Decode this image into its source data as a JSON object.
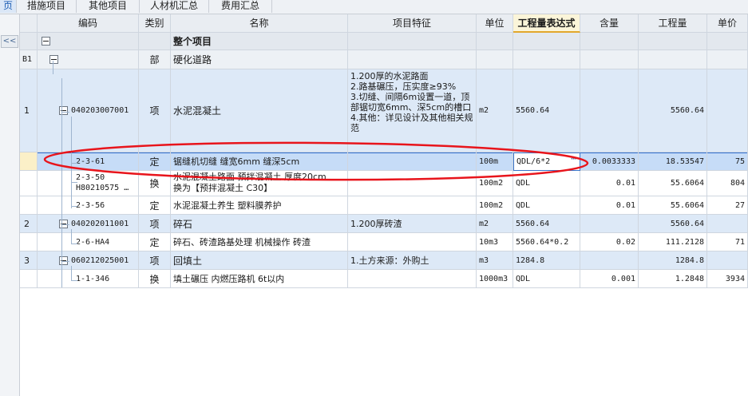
{
  "tabs": [
    {
      "label": "措施项目"
    },
    {
      "label": "其他项目"
    },
    {
      "label": "人材机汇总"
    },
    {
      "label": "费用汇总"
    }
  ],
  "left_panel": {
    "collapse_glyph": "<<",
    "tab_fragment": "页"
  },
  "columns": [
    "编码",
    "类别",
    "名称",
    "项目特征",
    "单位",
    "工程量表达式",
    "含量",
    "工程量",
    "单价"
  ],
  "rows": [
    {
      "idx": "",
      "code": "",
      "type": "",
      "name": "整个项目",
      "feature": "",
      "unit": "",
      "expr": "",
      "content": "",
      "qty": "",
      "price": ""
    },
    {
      "idx": "B1",
      "code": "",
      "type": "部",
      "name": "硬化道路",
      "feature": "",
      "unit": "",
      "expr": "",
      "content": "",
      "qty": "",
      "price": ""
    },
    {
      "idx": "1",
      "code": "040203007001",
      "type": "项",
      "name": "水泥混凝土",
      "feature": "1.200厚的水泥路面\n2.路基碾压，压实度≥93%\n3.切缝、间隔6m设置一道，顶部锯切宽6mm、深5cm的槽口\n4.其他：详见设计及其他相关规范",
      "unit": "m2",
      "expr": "5560.64",
      "content": "",
      "qty": "5560.64",
      "price": ""
    },
    {
      "idx": "",
      "code": "2-3-61",
      "type": "定",
      "name": "锯缝机切缝 缝宽6mm 缝深5cm",
      "feature": "",
      "unit": "100m",
      "expr": "QDL/6*2",
      "content": "0.0033333",
      "qty": "18.53547",
      "price": "75"
    },
    {
      "idx": "",
      "code": "2-3-50\nH80210575 …",
      "type": "换",
      "name": "水泥混凝土路面 预拌混凝土 厚度20cm\n换为【预拌混凝土 C30】",
      "feature": "",
      "unit": "100m2",
      "expr": "QDL",
      "content": "0.01",
      "qty": "55.6064",
      "price": "804"
    },
    {
      "idx": "",
      "code": "2-3-56",
      "type": "定",
      "name": "水泥混凝土养生 塑料膜养护",
      "feature": "",
      "unit": "100m2",
      "expr": "QDL",
      "content": "0.01",
      "qty": "55.6064",
      "price": "27"
    },
    {
      "idx": "2",
      "code": "040202011001",
      "type": "项",
      "name": "碎石",
      "feature": "1.200厚砖渣",
      "unit": "m2",
      "expr": "5560.64",
      "content": "",
      "qty": "5560.64",
      "price": ""
    },
    {
      "idx": "",
      "code": "2-6-HA4",
      "type": "定",
      "name": "碎石、砖渣路基处理 机械操作 砖渣",
      "feature": "",
      "unit": "10m3",
      "expr": "5560.64*0.2",
      "content": "0.02",
      "qty": "111.2128",
      "price": "71"
    },
    {
      "idx": "3",
      "code": "060212025001",
      "type": "项",
      "name": "回填土",
      "feature": "1.土方来源：外购土",
      "unit": "m3",
      "expr": "1284.8",
      "content": "",
      "qty": "1284.8",
      "price": ""
    },
    {
      "idx": "",
      "code": "1-1-346",
      "type": "换",
      "name": "填土碾压 内燃压路机 6t以内",
      "feature": "",
      "unit": "1000m3",
      "expr": "QDL",
      "content": "0.001",
      "qty": "1.2848",
      "price": "3934"
    }
  ],
  "colors": {
    "accent": "#e2a72c",
    "selected_row": "#c6dcf7",
    "item_row": "#dde9f7",
    "annotation": "#e8141b"
  }
}
